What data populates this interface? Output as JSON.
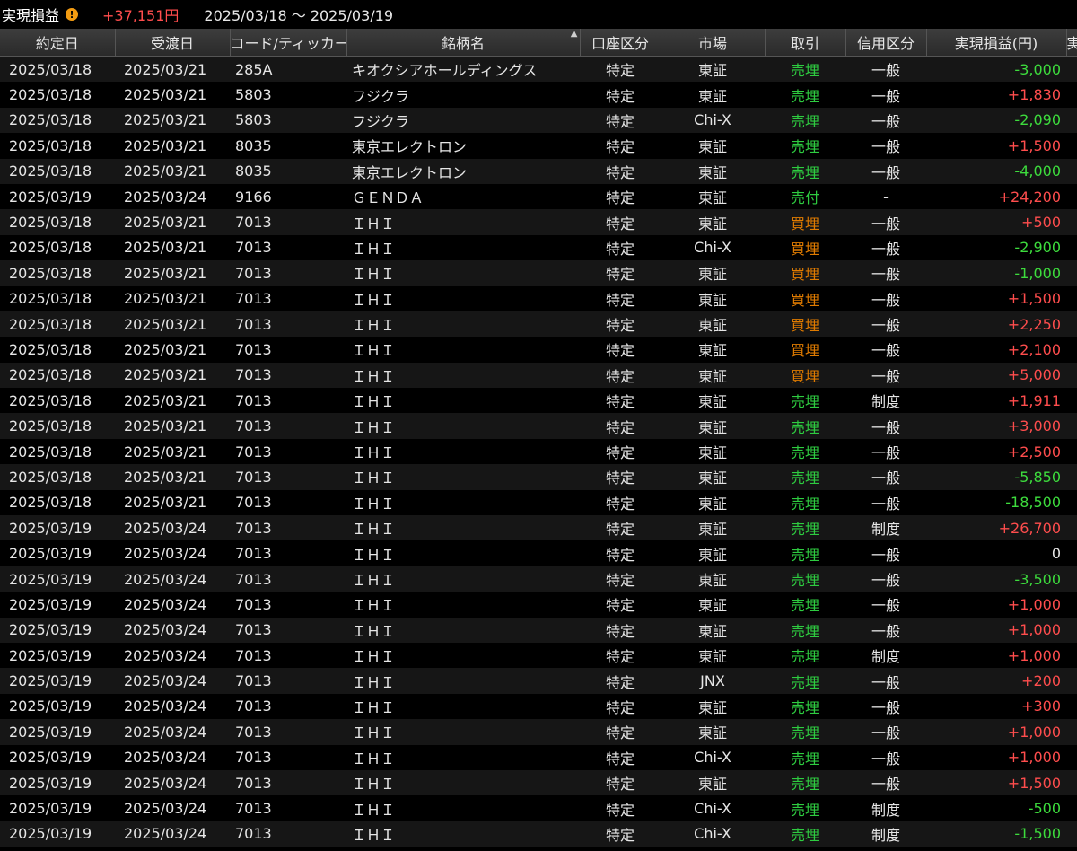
{
  "summary": {
    "label": "実現損益",
    "total": "+37,151円",
    "range": "2025/03/18 ～ 2025/03/19"
  },
  "headers": [
    "約定日",
    "受渡日",
    "コード/ティッカー",
    "銘柄名",
    "口座区分",
    "市場",
    "取引",
    "信用区分",
    "実現損益(円)",
    "実"
  ],
  "rows": [
    [
      "2025/03/18",
      "2025/03/21",
      "285A",
      "キオクシアホールディングス",
      "特定",
      "東証",
      "売埋",
      "一般",
      "-3,000"
    ],
    [
      "2025/03/18",
      "2025/03/21",
      "5803",
      "フジクラ",
      "特定",
      "東証",
      "売埋",
      "一般",
      "+1,830"
    ],
    [
      "2025/03/18",
      "2025/03/21",
      "5803",
      "フジクラ",
      "特定",
      "Chi-X",
      "売埋",
      "一般",
      "-2,090"
    ],
    [
      "2025/03/18",
      "2025/03/21",
      "8035",
      "東京エレクトロン",
      "特定",
      "東証",
      "売埋",
      "一般",
      "+1,500"
    ],
    [
      "2025/03/18",
      "2025/03/21",
      "8035",
      "東京エレクトロン",
      "特定",
      "東証",
      "売埋",
      "一般",
      "-4,000"
    ],
    [
      "2025/03/19",
      "2025/03/24",
      "9166",
      "ＧＥＮＤＡ",
      "特定",
      "東証",
      "売付",
      "-",
      "+24,200"
    ],
    [
      "2025/03/18",
      "2025/03/21",
      "7013",
      "ＩＨＩ",
      "特定",
      "東証",
      "買埋",
      "一般",
      "+500"
    ],
    [
      "2025/03/18",
      "2025/03/21",
      "7013",
      "ＩＨＩ",
      "特定",
      "Chi-X",
      "買埋",
      "一般",
      "-2,900"
    ],
    [
      "2025/03/18",
      "2025/03/21",
      "7013",
      "ＩＨＩ",
      "特定",
      "東証",
      "買埋",
      "一般",
      "-1,000"
    ],
    [
      "2025/03/18",
      "2025/03/21",
      "7013",
      "ＩＨＩ",
      "特定",
      "東証",
      "買埋",
      "一般",
      "+1,500"
    ],
    [
      "2025/03/18",
      "2025/03/21",
      "7013",
      "ＩＨＩ",
      "特定",
      "東証",
      "買埋",
      "一般",
      "+2,250"
    ],
    [
      "2025/03/18",
      "2025/03/21",
      "7013",
      "ＩＨＩ",
      "特定",
      "東証",
      "買埋",
      "一般",
      "+2,100"
    ],
    [
      "2025/03/18",
      "2025/03/21",
      "7013",
      "ＩＨＩ",
      "特定",
      "東証",
      "買埋",
      "一般",
      "+5,000"
    ],
    [
      "2025/03/18",
      "2025/03/21",
      "7013",
      "ＩＨＩ",
      "特定",
      "東証",
      "売埋",
      "制度",
      "+1,911"
    ],
    [
      "2025/03/18",
      "2025/03/21",
      "7013",
      "ＩＨＩ",
      "特定",
      "東証",
      "売埋",
      "一般",
      "+3,000"
    ],
    [
      "2025/03/18",
      "2025/03/21",
      "7013",
      "ＩＨＩ",
      "特定",
      "東証",
      "売埋",
      "一般",
      "+2,500"
    ],
    [
      "2025/03/18",
      "2025/03/21",
      "7013",
      "ＩＨＩ",
      "特定",
      "東証",
      "売埋",
      "一般",
      "-5,850"
    ],
    [
      "2025/03/18",
      "2025/03/21",
      "7013",
      "ＩＨＩ",
      "特定",
      "東証",
      "売埋",
      "一般",
      "-18,500"
    ],
    [
      "2025/03/19",
      "2025/03/24",
      "7013",
      "ＩＨＩ",
      "特定",
      "東証",
      "売埋",
      "制度",
      "+26,700"
    ],
    [
      "2025/03/19",
      "2025/03/24",
      "7013",
      "ＩＨＩ",
      "特定",
      "東証",
      "売埋",
      "一般",
      "0"
    ],
    [
      "2025/03/19",
      "2025/03/24",
      "7013",
      "ＩＨＩ",
      "特定",
      "東証",
      "売埋",
      "一般",
      "-3,500"
    ],
    [
      "2025/03/19",
      "2025/03/24",
      "7013",
      "ＩＨＩ",
      "特定",
      "東証",
      "売埋",
      "一般",
      "+1,000"
    ],
    [
      "2025/03/19",
      "2025/03/24",
      "7013",
      "ＩＨＩ",
      "特定",
      "東証",
      "売埋",
      "一般",
      "+1,000"
    ],
    [
      "2025/03/19",
      "2025/03/24",
      "7013",
      "ＩＨＩ",
      "特定",
      "東証",
      "売埋",
      "制度",
      "+1,000"
    ],
    [
      "2025/03/19",
      "2025/03/24",
      "7013",
      "ＩＨＩ",
      "特定",
      "JNX",
      "売埋",
      "一般",
      "+200"
    ],
    [
      "2025/03/19",
      "2025/03/24",
      "7013",
      "ＩＨＩ",
      "特定",
      "東証",
      "売埋",
      "一般",
      "+300"
    ],
    [
      "2025/03/19",
      "2025/03/24",
      "7013",
      "ＩＨＩ",
      "特定",
      "東証",
      "売埋",
      "一般",
      "+1,000"
    ],
    [
      "2025/03/19",
      "2025/03/24",
      "7013",
      "ＩＨＩ",
      "特定",
      "Chi-X",
      "売埋",
      "一般",
      "+1,000"
    ],
    [
      "2025/03/19",
      "2025/03/24",
      "7013",
      "ＩＨＩ",
      "特定",
      "東証",
      "売埋",
      "一般",
      "+1,500"
    ],
    [
      "2025/03/19",
      "2025/03/24",
      "7013",
      "ＩＨＩ",
      "特定",
      "Chi-X",
      "売埋",
      "制度",
      "-500"
    ],
    [
      "2025/03/19",
      "2025/03/24",
      "7013",
      "ＩＨＩ",
      "特定",
      "Chi-X",
      "売埋",
      "制度",
      "-1,500"
    ]
  ],
  "colors": {
    "profit": "#ff4d4d",
    "loss": "#3ddc3d",
    "sell": "#2ecc40",
    "buy": "#e07b00",
    "warn_icon": "#f39c12"
  }
}
